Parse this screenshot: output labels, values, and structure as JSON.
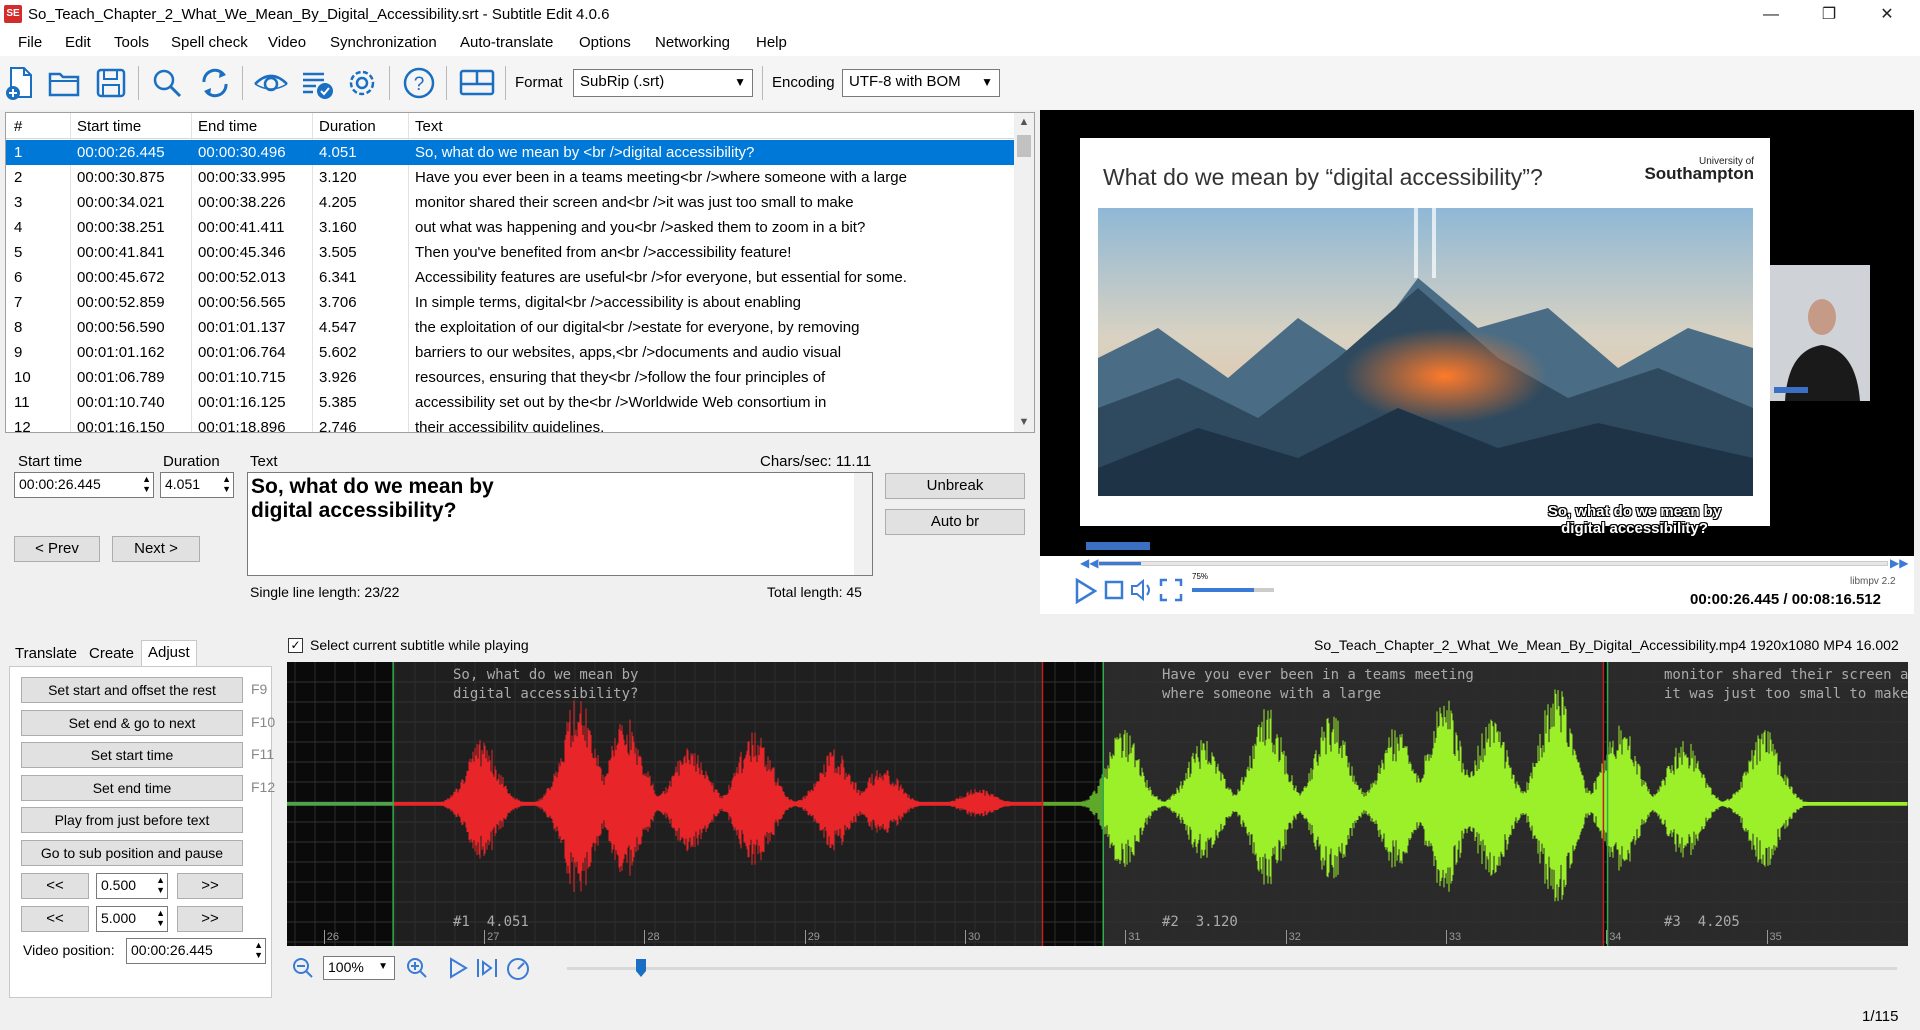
{
  "window": {
    "title": "So_Teach_Chapter_2_What_We_Mean_By_Digital_Accessibility.srt - Subtitle Edit 4.0.6",
    "app_icon": "SE",
    "minimize": "—",
    "maximize": "❐",
    "close": "✕"
  },
  "menu": [
    "File",
    "Edit",
    "Tools",
    "Spell check",
    "Video",
    "Synchronization",
    "Auto-translate",
    "Options",
    "Networking",
    "Help"
  ],
  "toolbar": {
    "format_label": "Format",
    "format_value": "SubRip (.srt)",
    "encoding_label": "Encoding",
    "encoding_value": "UTF-8 with BOM",
    "icons": [
      "new-file-icon",
      "open-folder-icon",
      "save-icon",
      "search-icon",
      "replace-icon",
      "visual-sync-icon",
      "spell-check-icon",
      "settings-icon",
      "help-icon",
      "layout-icon"
    ]
  },
  "grid": {
    "headers": [
      "#",
      "Start time",
      "End time",
      "Duration",
      "Text"
    ],
    "rows": [
      {
        "n": "1",
        "start": "00:00:26.445",
        "end": "00:00:30.496",
        "dur": "4.051",
        "text": "So, what do we mean by <br />digital accessibility?"
      },
      {
        "n": "2",
        "start": "00:00:30.875",
        "end": "00:00:33.995",
        "dur": "3.120",
        "text": "Have you ever been in a teams meeting<br />where someone with a large"
      },
      {
        "n": "3",
        "start": "00:00:34.021",
        "end": "00:00:38.226",
        "dur": "4.205",
        "text": "monitor shared their screen and<br />it was just too small to make"
      },
      {
        "n": "4",
        "start": "00:00:38.251",
        "end": "00:00:41.411",
        "dur": "3.160",
        "text": "out what was happening and you<br />asked them to zoom in a bit?"
      },
      {
        "n": "5",
        "start": "00:00:41.841",
        "end": "00:00:45.346",
        "dur": "3.505",
        "text": "Then you've benefited from an<br />accessibility feature!"
      },
      {
        "n": "6",
        "start": "00:00:45.672",
        "end": "00:00:52.013",
        "dur": "6.341",
        "text": "Accessibility features are useful<br />for everyone, but essential for some."
      },
      {
        "n": "7",
        "start": "00:00:52.859",
        "end": "00:00:56.565",
        "dur": "3.706",
        "text": "In simple terms, digital<br />accessibility is about enabling"
      },
      {
        "n": "8",
        "start": "00:00:56.590",
        "end": "00:01:01.137",
        "dur": "4.547",
        "text": "the exploitation of our digital<br />estate for everyone, by removing"
      },
      {
        "n": "9",
        "start": "00:01:01.162",
        "end": "00:01:06.764",
        "dur": "5.602",
        "text": "barriers to our websites, apps,<br />documents and audio visual"
      },
      {
        "n": "10",
        "start": "00:01:06.789",
        "end": "00:01:10.715",
        "dur": "3.926",
        "text": "resources, ensuring that they<br />follow the four principles of"
      },
      {
        "n": "11",
        "start": "00:01:10.740",
        "end": "00:01:16.125",
        "dur": "5.385",
        "text": "accessibility set out by the<br />Worldwide Web consortium in"
      },
      {
        "n": "12",
        "start": "00:01:16.150",
        "end": "00:01:18.896",
        "dur": "2.746",
        "text": "their accessibility guidelines."
      }
    ]
  },
  "edit": {
    "start_label": "Start time",
    "start_value": "00:00:26.445",
    "duration_label": "Duration",
    "duration_value": "4.051",
    "text_label": "Text",
    "chars_sec": "Chars/sec: 11.11",
    "text_line1": "So, what do we mean by",
    "text_line2": "digital accessibility?",
    "single_line": "Single line length: 23/22",
    "total_length": "Total length: 45",
    "prev": "< Prev",
    "next": "Next >",
    "unbreak": "Unbreak",
    "auto_br": "Auto br"
  },
  "video": {
    "slide_title": "What do we mean by “digital accessibility”?",
    "logo_small": "University of",
    "logo_big": "Southampton",
    "subtitle_line1": "So, what do we mean by",
    "subtitle_line2": "digital accessibility?",
    "volume": "75%",
    "engine": "libmpv 2.2",
    "time": "00:00:26.445 / 00:08:16.512",
    "progress": 0.053,
    "volume_level": 0.75
  },
  "tabs": {
    "items": [
      "Translate",
      "Create",
      "Adjust"
    ],
    "active": "Adjust"
  },
  "adjust": {
    "buttons": [
      {
        "label": "Set start and offset the rest",
        "key": "F9"
      },
      {
        "label": "Set end & go to next",
        "key": "F10"
      },
      {
        "label": "Set start time",
        "key": "F11"
      },
      {
        "label": "Set end time",
        "key": "F12"
      },
      {
        "label": "Play from just before text",
        "key": ""
      },
      {
        "label": "Go to sub position and pause",
        "key": ""
      }
    ],
    "back": "<<",
    "fwd": ">>",
    "step1": "0.500",
    "step2": "5.000",
    "video_pos_label": "Video position:",
    "video_pos": "00:00:26.445"
  },
  "waveform": {
    "select_checkbox_label": "Select current subtitle while playing",
    "select_checked": true,
    "file_info": "So_Teach_Chapter_2_What_We_Mean_By_Digital_Accessibility.mp4 1920x1080 MP4 16.002",
    "subs": [
      {
        "text1": "So, what do we mean by",
        "text2": "digital accessibility?",
        "label": "#1  4.051"
      },
      {
        "text1": "Have you ever been in a teams meeting",
        "text2": "where someone with a large",
        "label": "#2  3.120"
      },
      {
        "text1": "monitor shared their screen and",
        "text2": "it was just too small to make",
        "label": "#3  4.205"
      }
    ],
    "ticks": [
      "26",
      "27",
      "28",
      "29",
      "30",
      "31",
      "32",
      "33",
      "34",
      "35"
    ],
    "zoom": "100%",
    "colors": {
      "selected": "#e8262a",
      "other": "#9bf02a"
    }
  },
  "status": {
    "position": "1/115"
  }
}
